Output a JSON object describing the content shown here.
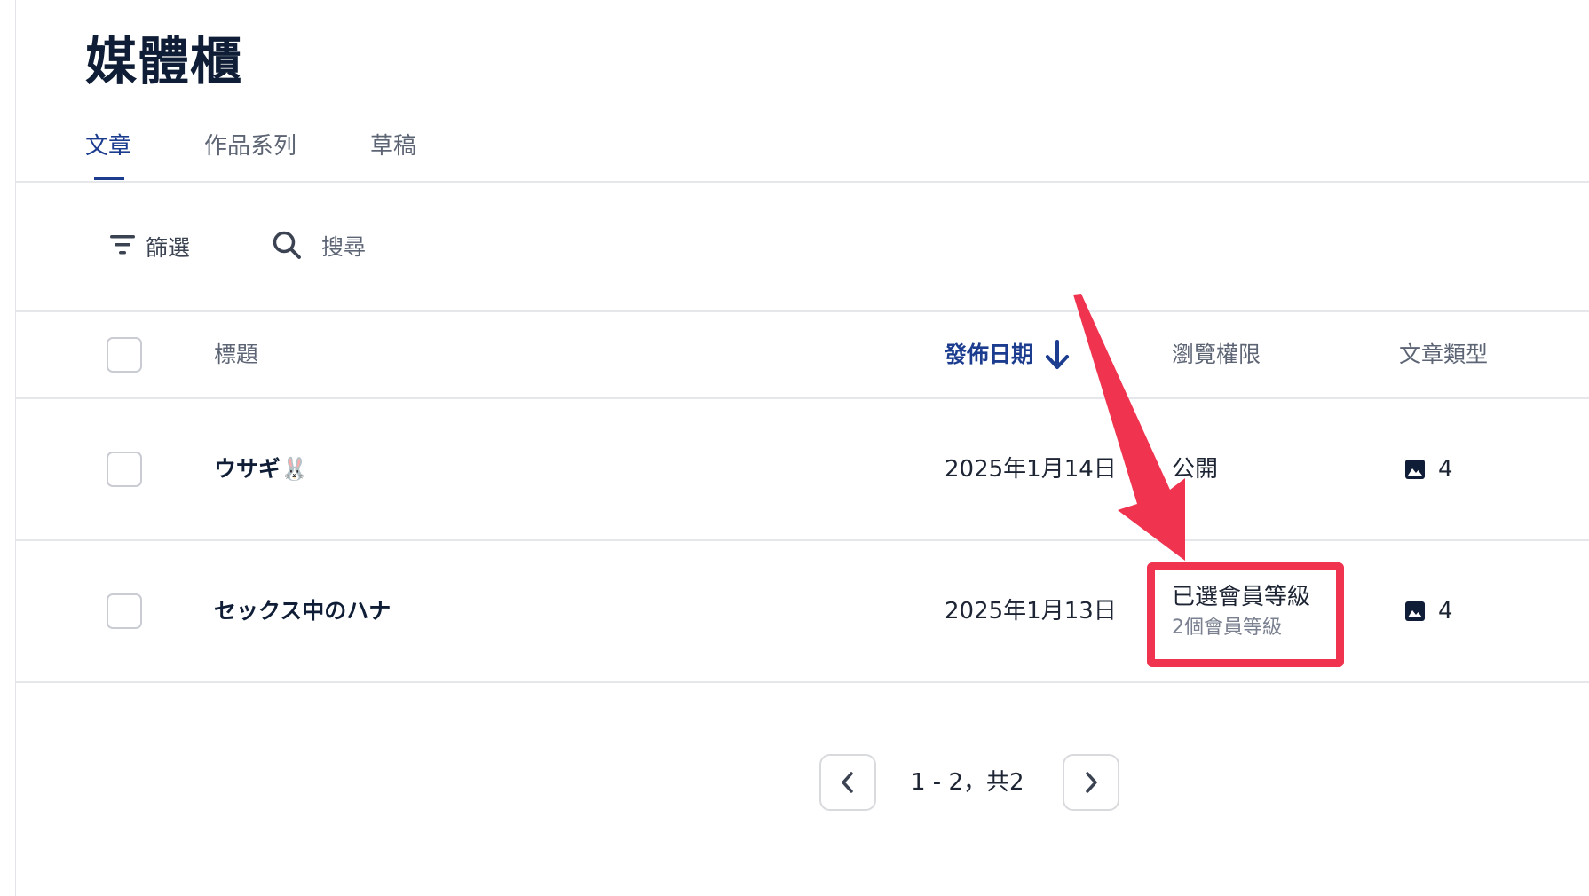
{
  "page": {
    "title": "媒體櫃"
  },
  "tabs": [
    {
      "label": "文章",
      "active": true
    },
    {
      "label": "作品系列",
      "active": false
    },
    {
      "label": "草稿",
      "active": false
    }
  ],
  "toolbar": {
    "filter_label": "篩選",
    "search_placeholder": "搜尋"
  },
  "table": {
    "headers": {
      "title": "標題",
      "publish_date": "發佈日期",
      "access": "瀏覽權限",
      "post_type": "文章類型"
    },
    "sort": {
      "column": "publish_date",
      "direction": "desc"
    },
    "rows": [
      {
        "title": "ウサギ🐰",
        "publish_date": "2025年1月14日",
        "access": "公開",
        "access_detail": "",
        "post_type_icon": "image-icon",
        "post_type_count": "4"
      },
      {
        "title": "セックス中のハナ",
        "publish_date": "2025年1月13日",
        "access": "已選會員等級",
        "access_detail": "2個會員等級",
        "post_type_icon": "image-icon",
        "post_type_count": "4"
      }
    ]
  },
  "pagination": {
    "text": "1 - 2，共2"
  },
  "colors": {
    "accent": "#1c3d8f",
    "annotation": "#f0344f",
    "text": "#0f1e36",
    "muted": "#5d6575"
  }
}
